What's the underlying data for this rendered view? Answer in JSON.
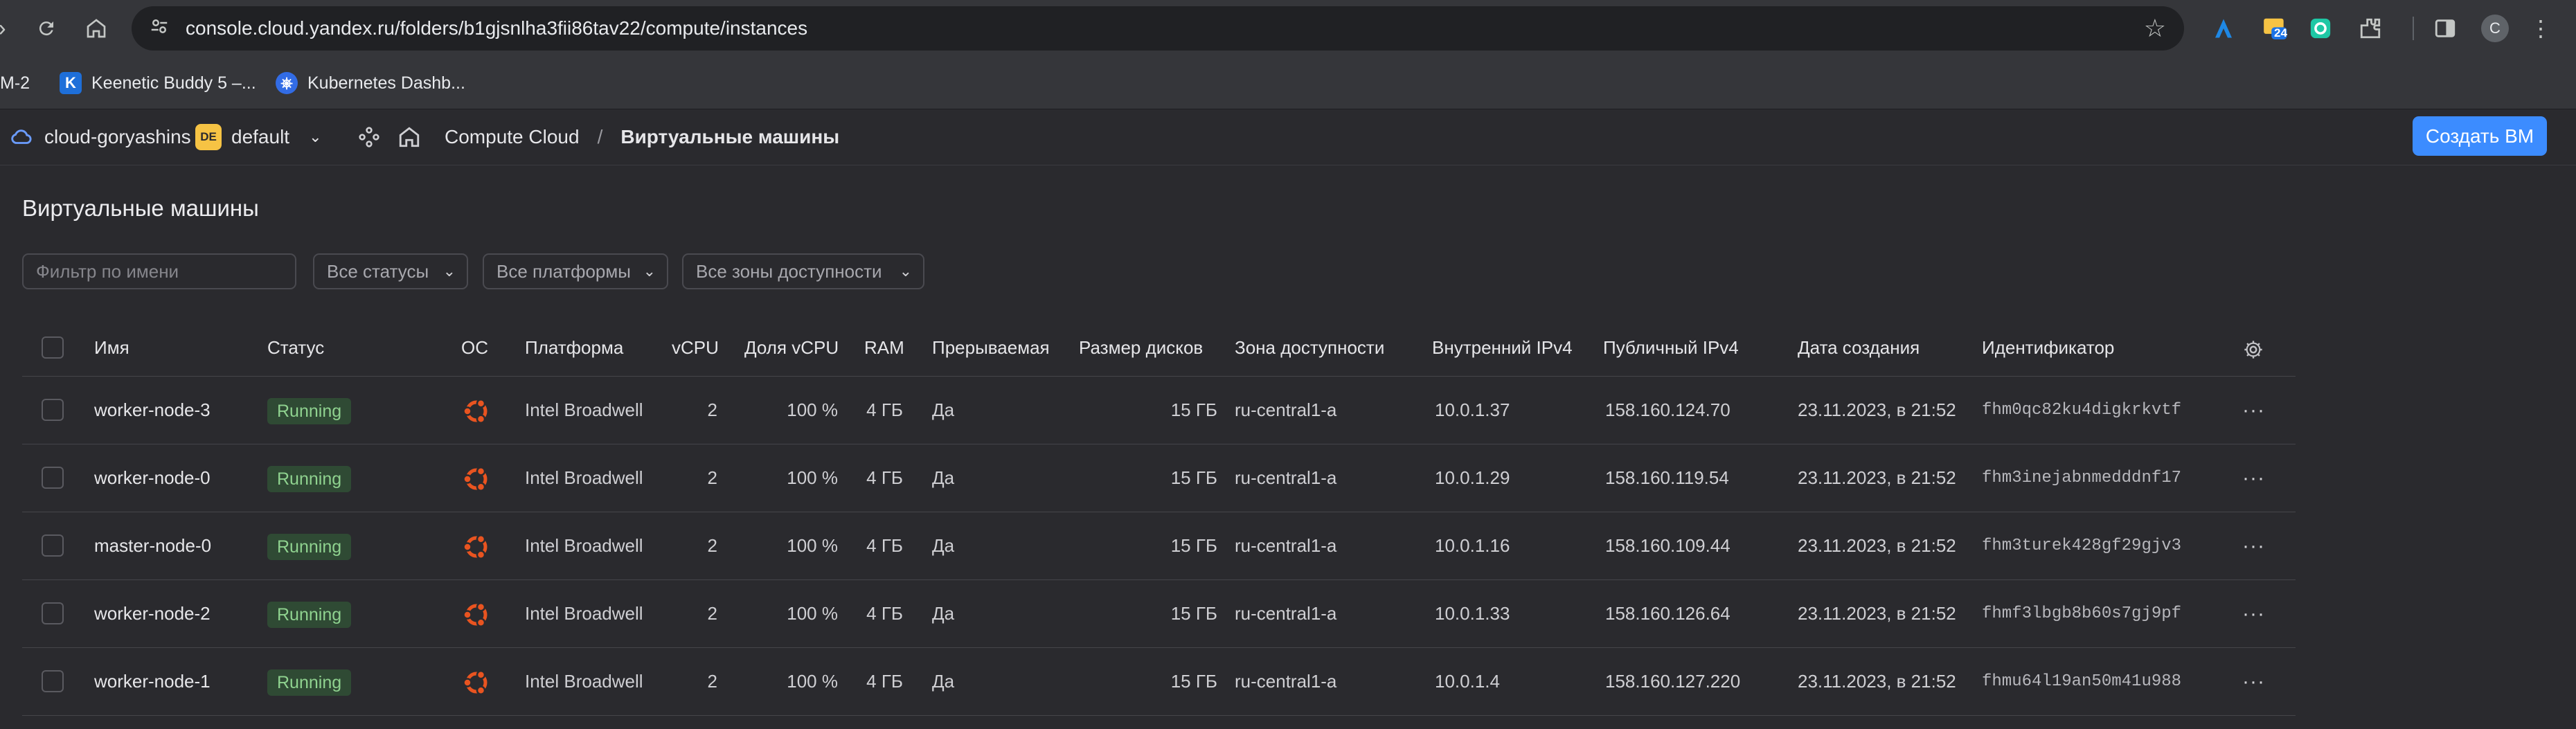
{
  "browser": {
    "url": "console.cloud.yandex.ru/folders/b1gjsnlha3fii86tav22/compute/instances",
    "ext_badge": "24",
    "profile_initial": "C",
    "bookmarks": [
      {
        "label": "M-2"
      },
      {
        "label": "Keenetic Buddy 5 –..."
      },
      {
        "label": "Kubernetes Dashb..."
      }
    ]
  },
  "header": {
    "cloud": "cloud-goryashins",
    "folder_badge": "DE",
    "folder": "default",
    "service": "Compute Cloud",
    "separator": "/",
    "section": "Виртуальные машины",
    "create_button": "Создать ВМ"
  },
  "page": {
    "title": "Виртуальные машины",
    "filter_placeholder": "Фильтр по имени",
    "status_filter": "Все статусы",
    "platform_filter": "Все платформы",
    "zone_filter": "Все зоны доступности"
  },
  "table": {
    "columns": {
      "name": "Имя",
      "status": "Статус",
      "os": "ОС",
      "platform": "Платформа",
      "vcpu": "vCPU",
      "vcpu_share": "Доля vCPU",
      "ram": "RAM",
      "preemptible": "Прерываемая",
      "disk_size": "Размер дисков",
      "zone": "Зона доступности",
      "internal_ip": "Внутренний IPv4",
      "public_ip": "Публичный IPv4",
      "created": "Дата создания",
      "id": "Идентификатор"
    },
    "rows": [
      {
        "name": "worker-node-3",
        "status": "Running",
        "os": "ubuntu-icon",
        "platform": "Intel Broadwell",
        "vcpu": "2",
        "vcpu_share": "100 %",
        "ram": "4 ГБ",
        "preemptible": "Да",
        "disk_size": "15 ГБ",
        "zone": "ru-central1-a",
        "internal_ip": "10.0.1.37",
        "public_ip": "158.160.124.70",
        "created": "23.11.2023, в 21:52",
        "id": "fhm0qc82ku4digkrkvtf"
      },
      {
        "name": "worker-node-0",
        "status": "Running",
        "os": "ubuntu-icon",
        "platform": "Intel Broadwell",
        "vcpu": "2",
        "vcpu_share": "100 %",
        "ram": "4 ГБ",
        "preemptible": "Да",
        "disk_size": "15 ГБ",
        "zone": "ru-central1-a",
        "internal_ip": "10.0.1.29",
        "public_ip": "158.160.119.54",
        "created": "23.11.2023, в 21:52",
        "id": "fhm3inejabnmedddnf17"
      },
      {
        "name": "master-node-0",
        "status": "Running",
        "os": "ubuntu-icon",
        "platform": "Intel Broadwell",
        "vcpu": "2",
        "vcpu_share": "100 %",
        "ram": "4 ГБ",
        "preemptible": "Да",
        "disk_size": "15 ГБ",
        "zone": "ru-central1-a",
        "internal_ip": "10.0.1.16",
        "public_ip": "158.160.109.44",
        "created": "23.11.2023, в 21:52",
        "id": "fhm3turek428gf29gjv3"
      },
      {
        "name": "worker-node-2",
        "status": "Running",
        "os": "ubuntu-icon",
        "platform": "Intel Broadwell",
        "vcpu": "2",
        "vcpu_share": "100 %",
        "ram": "4 ГБ",
        "preemptible": "Да",
        "disk_size": "15 ГБ",
        "zone": "ru-central1-a",
        "internal_ip": "10.0.1.33",
        "public_ip": "158.160.126.64",
        "created": "23.11.2023, в 21:52",
        "id": "fhmf3lbgb8b60s7gj9pf"
      },
      {
        "name": "worker-node-1",
        "status": "Running",
        "os": "ubuntu-icon",
        "platform": "Intel Broadwell",
        "vcpu": "2",
        "vcpu_share": "100 %",
        "ram": "4 ГБ",
        "preemptible": "Да",
        "disk_size": "15 ГБ",
        "zone": "ru-central1-a",
        "internal_ip": "10.0.1.4",
        "public_ip": "158.160.127.220",
        "created": "23.11.2023, в 21:52",
        "id": "fhmu64l19an50m41u988"
      }
    ]
  },
  "colors": {
    "accent": "#3c8cff",
    "status_running_bg": "#2f4a34",
    "status_running_text": "#8fd28f",
    "ubuntu": "#e95420",
    "folder_badge": "#f6c344"
  }
}
